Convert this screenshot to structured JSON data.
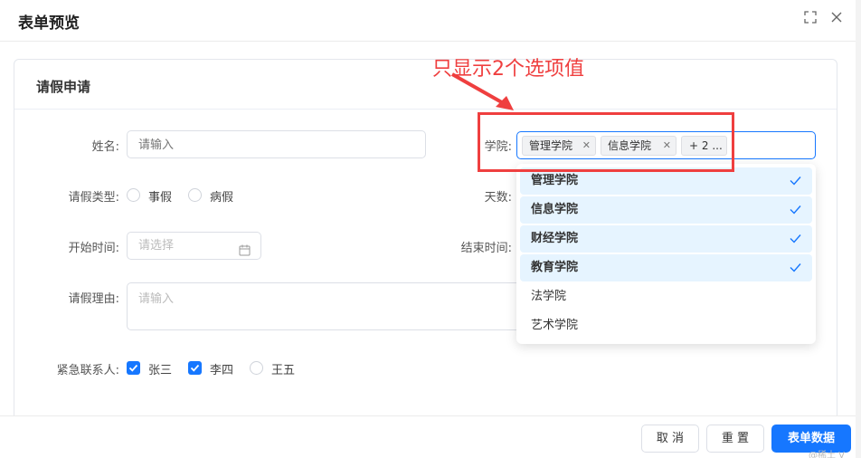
{
  "dialog": {
    "title": "表单预览",
    "icons": [
      "fullscreen-icon",
      "close-icon"
    ]
  },
  "card": {
    "title": "请假申请"
  },
  "form": {
    "name": {
      "label": "姓名:",
      "placeholder": "请输入"
    },
    "college": {
      "label": "学院:",
      "tags": [
        "管理学院",
        "信息学院"
      ],
      "more_tag": "+ 2 ..."
    },
    "leave_type": {
      "label": "请假类型:",
      "options": [
        "事假",
        "病假"
      ]
    },
    "days": {
      "label": "天数:"
    },
    "start_time": {
      "label": "开始时间:",
      "placeholder": "请选择"
    },
    "end_time": {
      "label": "结束时间:"
    },
    "reason": {
      "label": "请假理由:",
      "placeholder": "请输入"
    },
    "contacts": {
      "label": "紧急联系人:",
      "options": [
        {
          "label": "张三",
          "checked": true
        },
        {
          "label": "李四",
          "checked": true
        },
        {
          "label": "王五",
          "checked": false
        }
      ]
    }
  },
  "dropdown": {
    "items": [
      {
        "label": "管理学院",
        "selected": true
      },
      {
        "label": "信息学院",
        "selected": true
      },
      {
        "label": "财经学院",
        "selected": true
      },
      {
        "label": "教育学院",
        "selected": true
      },
      {
        "label": "法学院",
        "selected": false
      },
      {
        "label": "艺术学院",
        "selected": false
      }
    ]
  },
  "annotation": {
    "text": "只显示2个选项值",
    "color": "#ef3f3f"
  },
  "footer": {
    "cancel_label": "取 消",
    "reset_label": "重 置",
    "submit_label": "表单数据"
  },
  "watermark": "@稀土 V",
  "colors": {
    "primary": "#1677ff",
    "annotation": "#ef3f3f",
    "selected_bg": "#e6f4ff"
  }
}
